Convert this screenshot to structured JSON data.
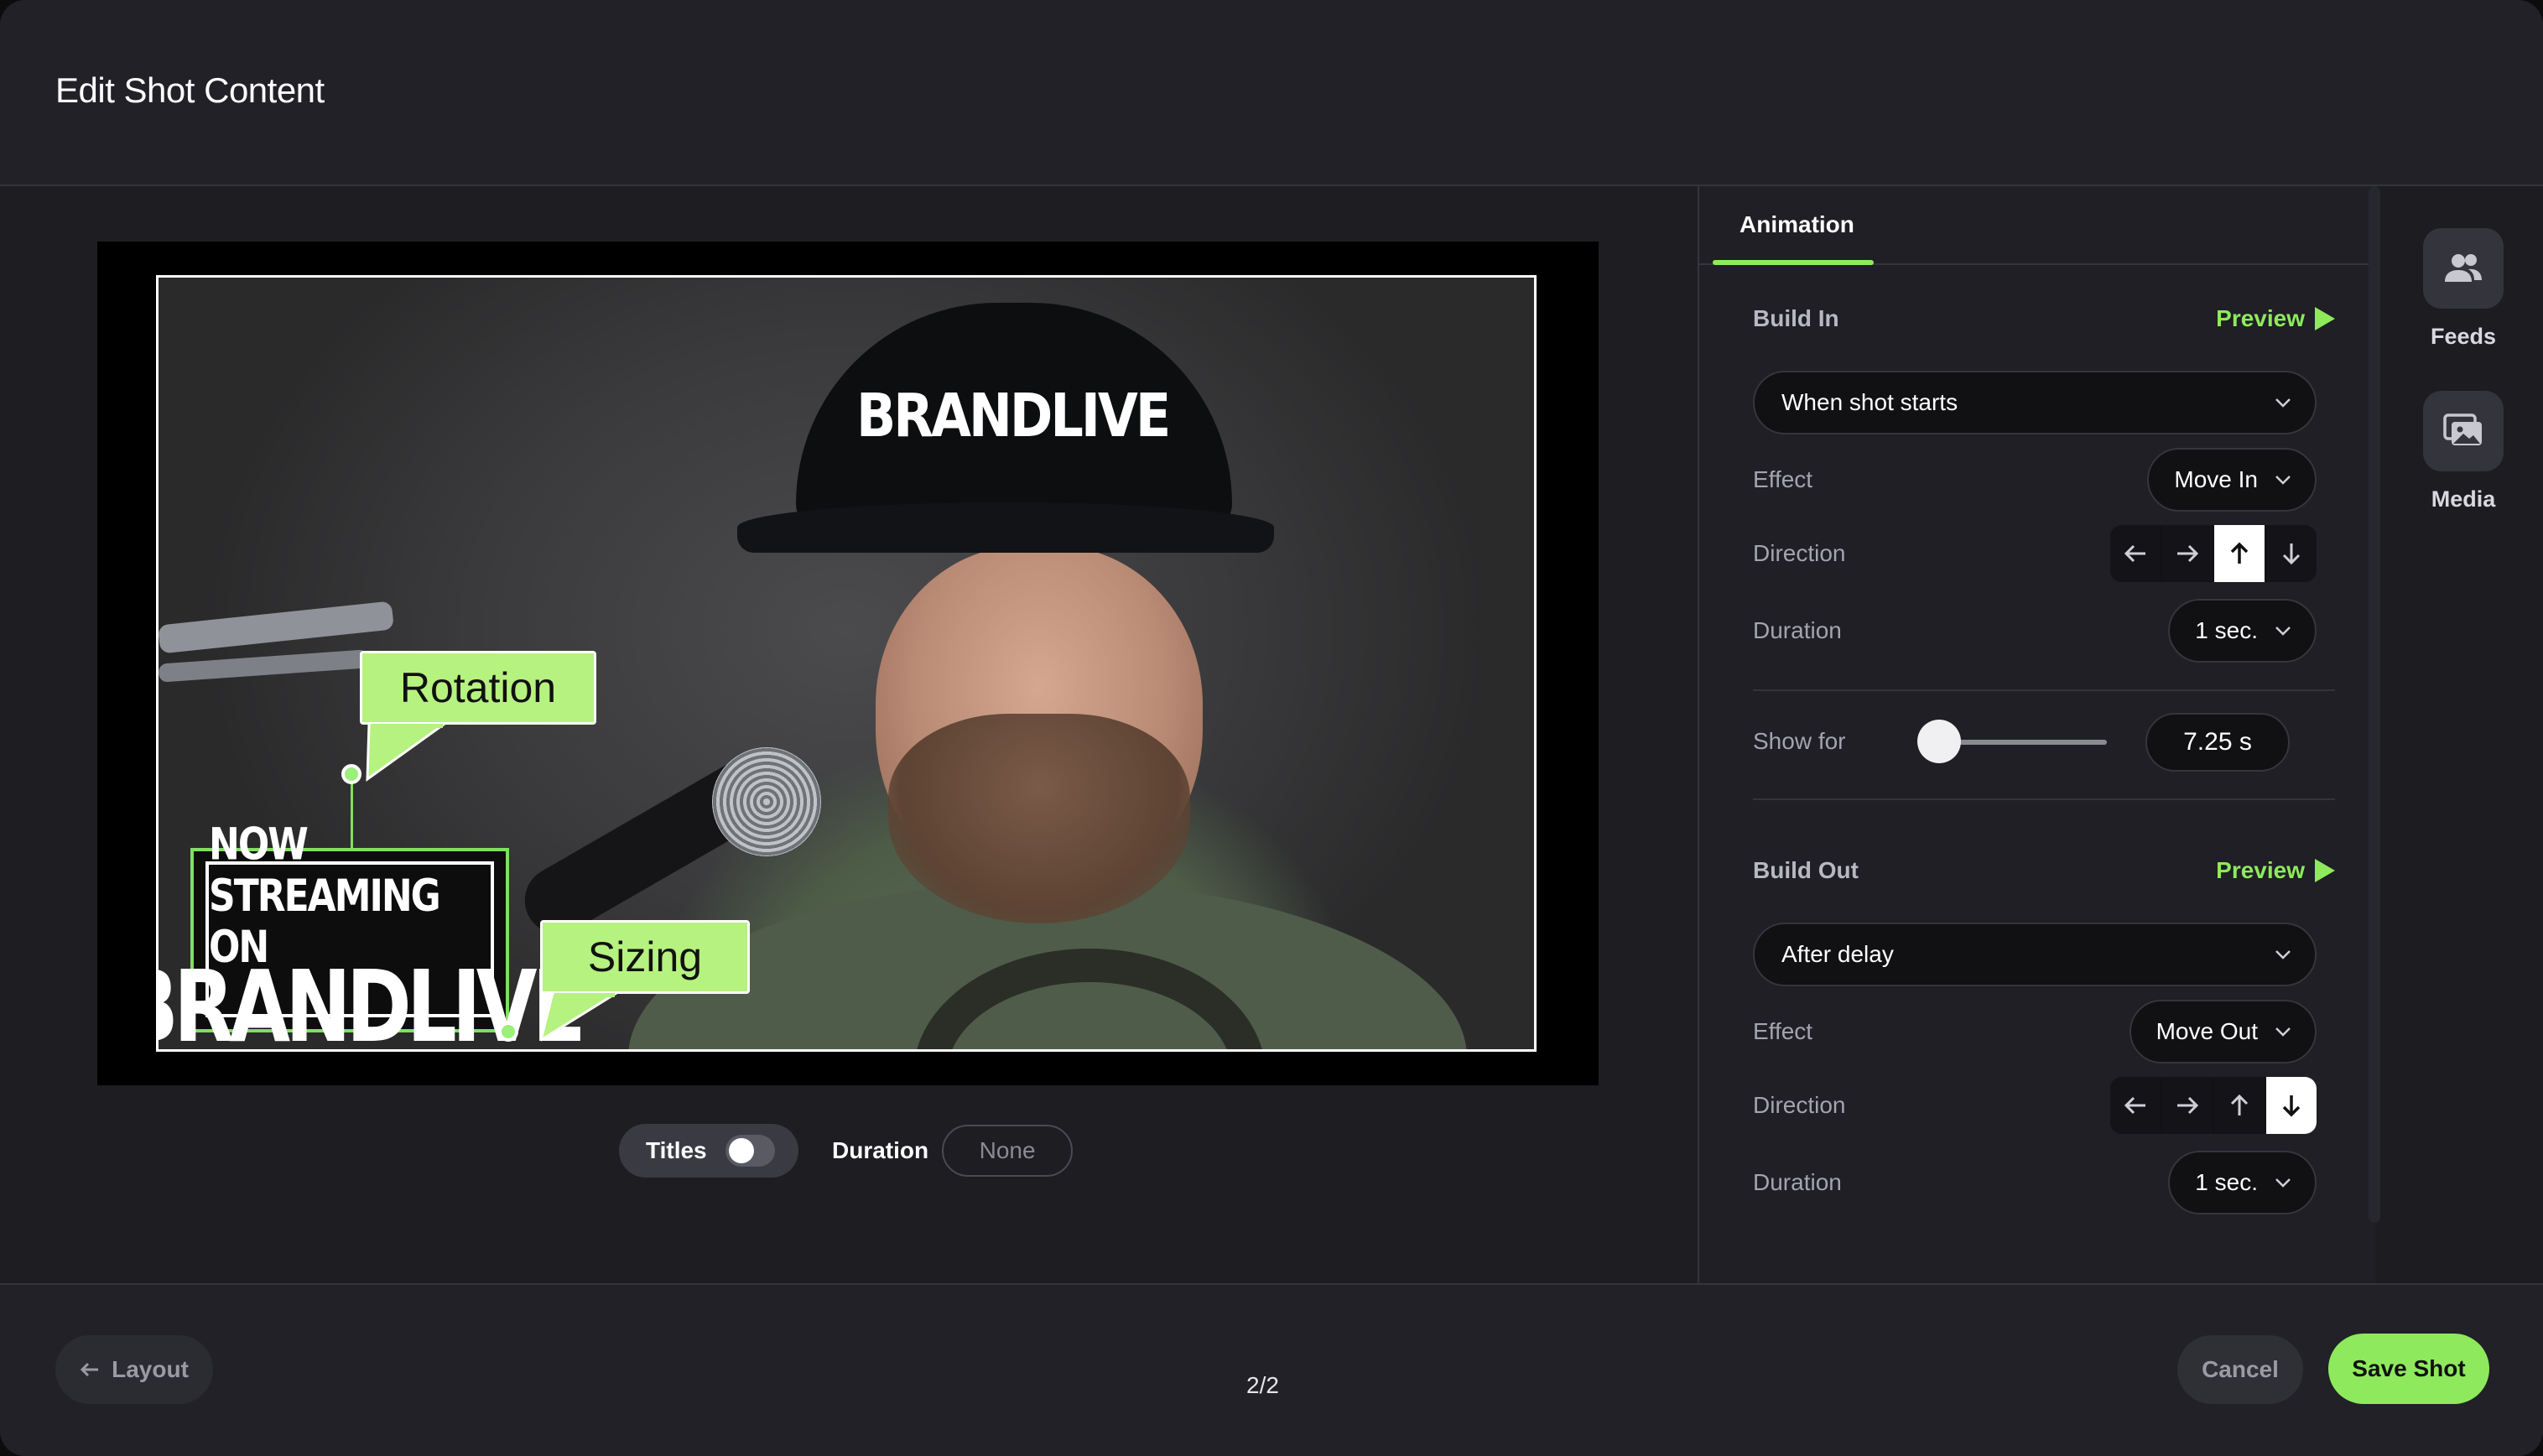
{
  "header": {
    "title": "Edit Shot Content"
  },
  "stage": {
    "hat_logo": "BRANDLIVE",
    "overlay": {
      "line1": "NOW STREAMING ON",
      "line2": "BRANDLIVE"
    },
    "callouts": {
      "rotation": "Rotation",
      "sizing": "Sizing"
    },
    "controls": {
      "titles_label": "Titles",
      "titles_on": false,
      "duration_label": "Duration",
      "duration_value": "None"
    }
  },
  "panel": {
    "tab": "Animation",
    "build_in": {
      "title": "Build In",
      "preview": "Preview",
      "trigger": "When shot starts",
      "effect_label": "Effect",
      "effect_value": "Move In",
      "direction_label": "Direction",
      "direction_selected": "up",
      "duration_label": "Duration",
      "duration_value": "1 sec."
    },
    "show_for": {
      "label": "Show for",
      "value": "7.25 s"
    },
    "build_out": {
      "title": "Build Out",
      "preview": "Preview",
      "trigger": "After delay",
      "effect_label": "Effect",
      "effect_value": "Move Out",
      "direction_label": "Direction",
      "direction_selected": "down",
      "duration_label": "Duration",
      "duration_value": "1 sec."
    }
  },
  "rail": {
    "feeds": "Feeds",
    "media": "Media"
  },
  "footer": {
    "layout": "Layout",
    "pager": "2/2",
    "cancel": "Cancel",
    "save": "Save Shot"
  },
  "colors": {
    "accent": "#8eea5c",
    "callout": "#b6f27f",
    "background": "#1c1c21"
  }
}
